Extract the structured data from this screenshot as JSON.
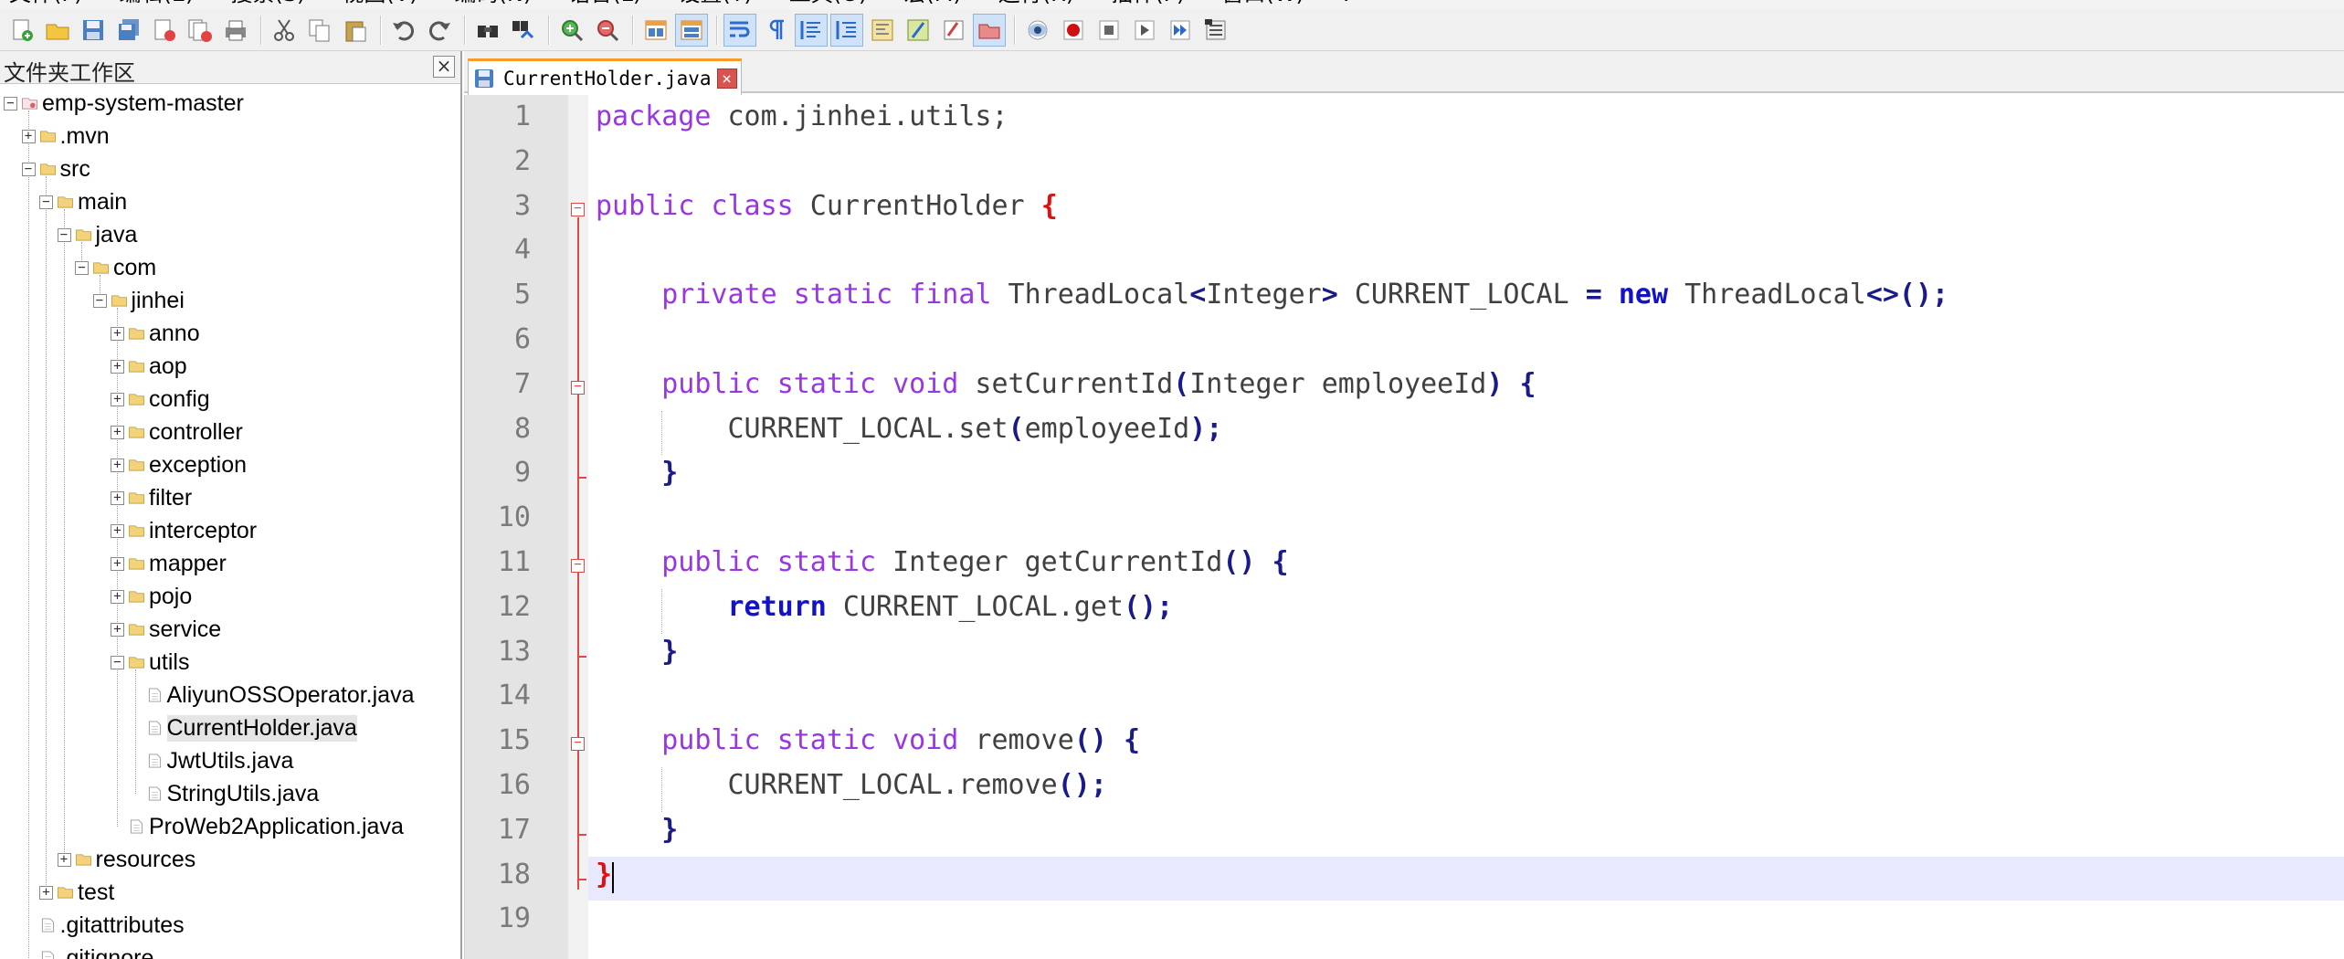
{
  "menubar": {
    "items": [
      "文件(F)",
      "编辑(E)",
      "搜索(S)",
      "视图(V)",
      "编码(N)",
      "语言(L)",
      "设置(T)",
      "工具(O)",
      "宏(M)",
      "运行(R)",
      "插件(P)",
      "窗口(W)",
      "?"
    ]
  },
  "toolbar": {
    "buttons": [
      "new-file-icon",
      "open-file-icon",
      "save-icon",
      "save-all-icon",
      "close-icon",
      "close-all-icon",
      "print-icon",
      "cut-icon",
      "copy-icon",
      "paste-icon",
      "undo-icon",
      "redo-icon",
      "find-icon",
      "replace-icon",
      "zoom-in-icon",
      "zoom-out-icon",
      "sync-vertical-icon",
      "sync-horizontal-icon",
      "word-wrap-icon",
      "show-all-chars-icon",
      "indent-guide-icon",
      "udl-icon",
      "doc-map-icon",
      "function-list-icon",
      "folder-workspace-icon",
      "monitoring-icon",
      "record-macro-icon",
      "stop-macro-icon",
      "play-macro-icon",
      "run-macro-multiple-icon",
      "save-macro-icon",
      "abc-spellcheck-icon"
    ]
  },
  "left_panel": {
    "title": "文件夹工作区",
    "close_label": "×",
    "tree": [
      {
        "label": "emp-system-master",
        "depth": 0,
        "expander": "-",
        "type": "project"
      },
      {
        "label": ".mvn",
        "depth": 1,
        "expander": "+",
        "type": "folder"
      },
      {
        "label": "src",
        "depth": 1,
        "expander": "-",
        "type": "folder"
      },
      {
        "label": "main",
        "depth": 2,
        "expander": "-",
        "type": "folder"
      },
      {
        "label": "java",
        "depth": 3,
        "expander": "-",
        "type": "folder"
      },
      {
        "label": "com",
        "depth": 4,
        "expander": "-",
        "type": "folder"
      },
      {
        "label": "jinhei",
        "depth": 5,
        "expander": "-",
        "type": "folder"
      },
      {
        "label": "anno",
        "depth": 6,
        "expander": "+",
        "type": "folder"
      },
      {
        "label": "aop",
        "depth": 6,
        "expander": "+",
        "type": "folder"
      },
      {
        "label": "config",
        "depth": 6,
        "expander": "+",
        "type": "folder"
      },
      {
        "label": "controller",
        "depth": 6,
        "expander": "+",
        "type": "folder"
      },
      {
        "label": "exception",
        "depth": 6,
        "expander": "+",
        "type": "folder"
      },
      {
        "label": "filter",
        "depth": 6,
        "expander": "+",
        "type": "folder"
      },
      {
        "label": "interceptor",
        "depth": 6,
        "expander": "+",
        "type": "folder"
      },
      {
        "label": "mapper",
        "depth": 6,
        "expander": "+",
        "type": "folder"
      },
      {
        "label": "pojo",
        "depth": 6,
        "expander": "+",
        "type": "folder"
      },
      {
        "label": "service",
        "depth": 6,
        "expander": "+",
        "type": "folder"
      },
      {
        "label": "utils",
        "depth": 6,
        "expander": "-",
        "type": "folder"
      },
      {
        "label": "AliyunOSSOperator.java",
        "depth": 7,
        "expander": "",
        "type": "file"
      },
      {
        "label": "CurrentHolder.java",
        "depth": 7,
        "expander": "",
        "type": "file",
        "selected": true
      },
      {
        "label": "JwtUtils.java",
        "depth": 7,
        "expander": "",
        "type": "file"
      },
      {
        "label": "StringUtils.java",
        "depth": 7,
        "expander": "",
        "type": "file"
      },
      {
        "label": "ProWeb2Application.java",
        "depth": 6,
        "expander": "",
        "type": "file"
      },
      {
        "label": "resources",
        "depth": 3,
        "expander": "+",
        "type": "folder"
      },
      {
        "label": "test",
        "depth": 2,
        "expander": "+",
        "type": "folder"
      },
      {
        "label": ".gitattributes",
        "depth": 1,
        "expander": "",
        "type": "file"
      },
      {
        "label": ".gitignore",
        "depth": 1,
        "expander": "",
        "type": "file"
      }
    ]
  },
  "tabs": [
    {
      "label": "CurrentHolder.java",
      "close_label": "×",
      "active": true
    }
  ],
  "editor": {
    "current_line": 18,
    "lines": [
      [
        [
          "kw",
          "package"
        ],
        [
          "txt",
          " com.jinhei.utils;"
        ]
      ],
      [],
      [
        [
          "kw",
          "public"
        ],
        [
          "txt",
          " "
        ],
        [
          "kw",
          "class"
        ],
        [
          "txt",
          " CurrentHolder "
        ],
        [
          "brace-red",
          "{"
        ]
      ],
      [],
      [
        [
          "txt",
          "    "
        ],
        [
          "kw",
          "private"
        ],
        [
          "txt",
          " "
        ],
        [
          "kw",
          "static"
        ],
        [
          "txt",
          " "
        ],
        [
          "kw",
          "final"
        ],
        [
          "txt",
          " ThreadLocal"
        ],
        [
          "op",
          "<"
        ],
        [
          "txt",
          "Integer"
        ],
        [
          "op",
          ">"
        ],
        [
          "txt",
          " CURRENT_LOCAL "
        ],
        [
          "op",
          "="
        ],
        [
          "txt",
          " "
        ],
        [
          "kw2",
          "new"
        ],
        [
          "txt",
          " ThreadLocal"
        ],
        [
          "op",
          "<>();"
        ]
      ],
      [],
      [
        [
          "txt",
          "    "
        ],
        [
          "kw",
          "public"
        ],
        [
          "txt",
          " "
        ],
        [
          "kw",
          "static"
        ],
        [
          "txt",
          " "
        ],
        [
          "kw",
          "void"
        ],
        [
          "txt",
          " setCurrentId"
        ],
        [
          "op",
          "("
        ],
        [
          "txt",
          "Integer employeeId"
        ],
        [
          "op",
          ")"
        ],
        [
          "txt",
          " "
        ],
        [
          "op",
          "{"
        ]
      ],
      [
        [
          "txt",
          "        CURRENT_LOCAL.set"
        ],
        [
          "op",
          "("
        ],
        [
          "txt",
          "employeeId"
        ],
        [
          "op",
          ");"
        ]
      ],
      [
        [
          "txt",
          "    "
        ],
        [
          "op",
          "}"
        ]
      ],
      [],
      [
        [
          "txt",
          "    "
        ],
        [
          "kw",
          "public"
        ],
        [
          "txt",
          " "
        ],
        [
          "kw",
          "static"
        ],
        [
          "txt",
          " Integer getCurrentId"
        ],
        [
          "op",
          "()"
        ],
        [
          "txt",
          " "
        ],
        [
          "op",
          "{"
        ]
      ],
      [
        [
          "txt",
          "        "
        ],
        [
          "kw2",
          "return"
        ],
        [
          "txt",
          " CURRENT_LOCAL.get"
        ],
        [
          "op",
          "();"
        ]
      ],
      [
        [
          "txt",
          "    "
        ],
        [
          "op",
          "}"
        ]
      ],
      [],
      [
        [
          "txt",
          "    "
        ],
        [
          "kw",
          "public"
        ],
        [
          "txt",
          " "
        ],
        [
          "kw",
          "static"
        ],
        [
          "txt",
          " "
        ],
        [
          "kw",
          "void"
        ],
        [
          "txt",
          " remove"
        ],
        [
          "op",
          "()"
        ],
        [
          "txt",
          " "
        ],
        [
          "op",
          "{"
        ]
      ],
      [
        [
          "txt",
          "        CURRENT_LOCAL.remove"
        ],
        [
          "op",
          "();"
        ]
      ],
      [
        [
          "txt",
          "    "
        ],
        [
          "op",
          "}"
        ]
      ],
      [
        [
          "brace-red",
          "}"
        ]
      ],
      []
    ]
  }
}
